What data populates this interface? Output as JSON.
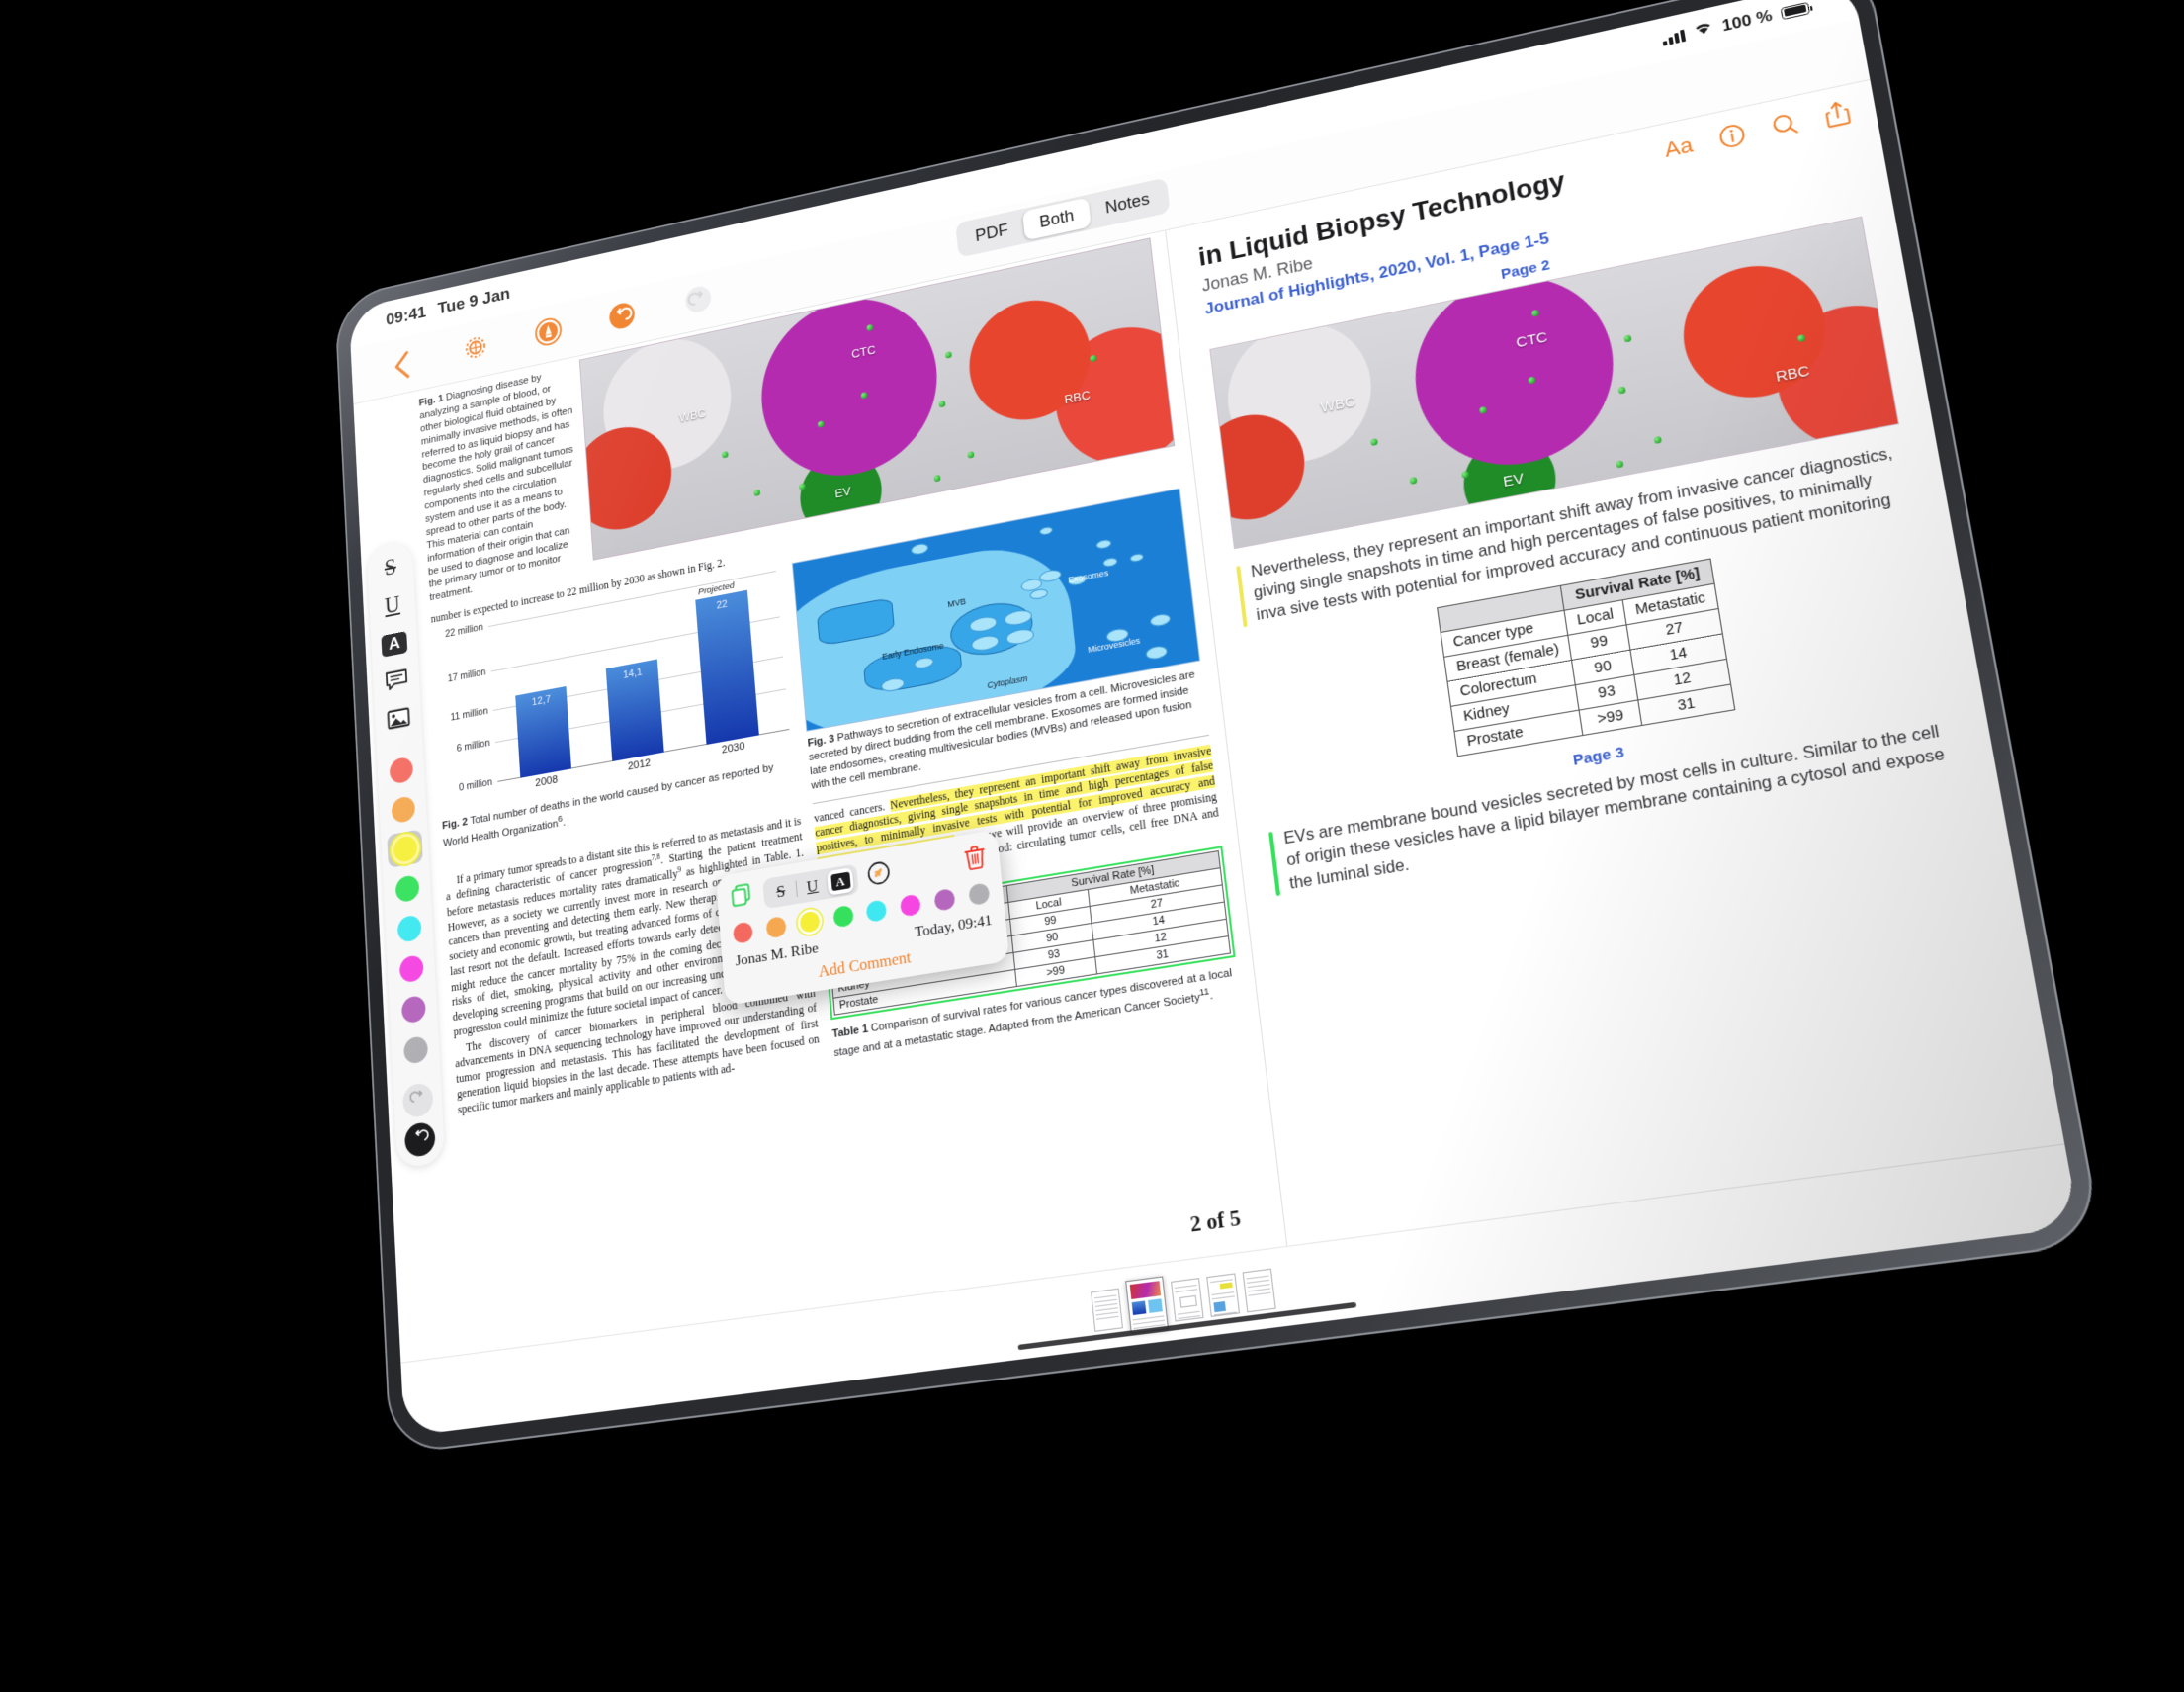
{
  "status_bar": {
    "time": "09:41",
    "date": "Tue 9 Jan",
    "battery_percent": "100 %"
  },
  "toolbar": {
    "back_icon": "chevron-left-icon",
    "settings_icon": "gear-icon",
    "annotate_icon": "pen-circle-icon",
    "undo_icon": "undo-icon",
    "redo_icon": "redo-icon"
  },
  "view_mode": {
    "options": [
      "PDF",
      "Both",
      "Notes"
    ],
    "selected": "Both"
  },
  "sidebar": {
    "tools": [
      {
        "name": "strikethrough-tool",
        "label": "S"
      },
      {
        "name": "underline-tool",
        "label": "U"
      },
      {
        "name": "highlight-tool",
        "label": "A",
        "selected": true
      },
      {
        "name": "comment-tool",
        "label": "comment-bubble-icon"
      },
      {
        "name": "image-tool",
        "label": "image-icon"
      }
    ],
    "colors": [
      {
        "name": "red",
        "hex": "#f4695f",
        "selected": false
      },
      {
        "name": "orange",
        "hex": "#f5a84f",
        "selected": false
      },
      {
        "name": "yellow",
        "hex": "#f6ef3a",
        "selected": true
      },
      {
        "name": "green",
        "hex": "#35e15c",
        "selected": false
      },
      {
        "name": "cyan",
        "hex": "#3fe8f0",
        "selected": false
      },
      {
        "name": "magenta",
        "hex": "#f martin",
        "selected": false
      },
      {
        "name": "purple",
        "hex": "#b566bd",
        "selected": false
      },
      {
        "name": "gray",
        "hex": "#b0b0b4",
        "selected": false
      }
    ],
    "redo_label": "redo-icon",
    "undo_label": "undo-icon"
  },
  "pdf": {
    "fig1": {
      "caption_prefix": "Fig. 1",
      "caption": "Diagnosing disease by analyzing a sample of blood, or other biological fluid obtained by minimally invasive methods, is often referred to as liquid biopsy and has become the holy grail of cancer diagnostics. Solid malignant tumors regularly shed cells and subcellular components into the circulation system and use it as a means to spread to other parts of the body. This material can contain information of their origin that can be used to diagnose and localize the primary tumor or to monitor treatment.",
      "image_labels": [
        "WBC",
        "CTC",
        "RBC",
        "EV"
      ]
    },
    "lead_text": "number is expected to increase to 22 million by 2030 as shown in Fig. 2.",
    "fig2_caption_prefix": "Fig. 2",
    "fig2_caption": "Total number of deaths in the world caused by cancer as reported by World Health Organization",
    "fig2_caption_sup": "6",
    "para_left_1": "If a primary tumor spreads to a distant site this is referred to as metastasis and it is a defining characteristic of cancer progression",
    "para_left_1b": ". Starting the patient treatment before metastasis reduces mortality rates dramatically",
    "para_left_1c": " as highlighted in Table. 1. However, as a society we currently invest more in research on treating advanced cancers than preventing and detecting them early. New therapies generally benefit society and economic growth, but treating advanced forms of cancer should be our last resort not the default. Increased efforts towards early detection and prevention might reduce the cancer mortality by 75% in the coming decades",
    "para_left_1d": ". Limiting the risks of diet, smoking, physical activity and other environmental factors while developing screening programs that build on our increasing understanding of tumor progression could minimize the future societal impact of cancer.",
    "para_left_2": "The discovery of cancer biomarkers in peripheral blood combined with advancements in DNA sequencing technology have improved our understanding of tumor progression and metastasis. This has facilitated the development of first generation liquid biopsies in the last decade. These attempts have been focused on specific tumor markers and mainly applicable to patients with ad-",
    "fig3": {
      "caption_prefix": "Fig. 3",
      "caption": "Pathways to secretion of extracellular vesicles from a cell. Microvesicles are secreted by direct budding from the cell membrane. Exosomes are formed inside late endosomes, creating multivesicular bodies (MVBs) and released upon fusion with the cell membrane.",
      "diagram_labels": [
        "Early Endosome",
        "MVB",
        "Exosomes",
        "Microvesicles",
        "Cytoplasm"
      ]
    },
    "para_right_lead": "vanced cancers. ",
    "para_right_highlight": "Nevertheless, they represent an important shift away from invasive cancer diagnostics, giving single snapshots in time and high percentages of false positives, to minimally invasive tests with potential for improved accuracy and continuous patient monitoring.",
    "para_right_tail": " Here, we will provide an overview of three promising circulating tumor markers found in blood: circulating tumor cells, cell free DNA and extracellular vesicles.",
    "table1_caption_prefix": "Table 1",
    "table1_caption": "Comparison of survival rates for various cancer types discovered at a local stage and at a metastatic stage. Adapted from the American Cancer Society",
    "table1_caption_sup": "11",
    "page_counter": "2 of 5"
  },
  "chart_data": {
    "type": "bar",
    "title": "",
    "categories": [
      "2008",
      "2012",
      "2030"
    ],
    "values": [
      12.7,
      14.1,
      22
    ],
    "value_labels": [
      "12,7",
      "14,1",
      "22"
    ],
    "annotations": [
      "Projected"
    ],
    "ytick_labels": [
      "0 million",
      "6 million",
      "11 million",
      "17 million",
      "22 million"
    ],
    "ytick_values": [
      0,
      6,
      11,
      17,
      22
    ],
    "ylim": [
      0,
      24
    ],
    "xlabel": "",
    "ylabel": "",
    "grid": true,
    "legend": "none",
    "caption": "Fig. 2 Total number of deaths in the world caused by cancer as reported by World Health Organization."
  },
  "popup": {
    "copy_icon": "copy-icon",
    "format_buttons": [
      {
        "name": "strikethrough-button",
        "label": "S",
        "active": false
      },
      {
        "name": "underline-button",
        "label": "U",
        "active": false
      },
      {
        "name": "highlight-button",
        "label": "A",
        "active": true
      }
    ],
    "link_icon": "link-icon",
    "delete_icon": "trash-icon",
    "colors": [
      {
        "name": "red",
        "hex": "#f4695f",
        "selected": false
      },
      {
        "name": "orange",
        "hex": "#f5a84f",
        "selected": false
      },
      {
        "name": "yellow",
        "hex": "#f6ef3a",
        "selected": true
      },
      {
        "name": "green",
        "hex": "#35e15c",
        "selected": false
      },
      {
        "name": "cyan",
        "hex": "#3fe8f0",
        "selected": false
      },
      {
        "name": "magenta",
        "hex": "#f546e2",
        "selected": false
      },
      {
        "name": "purple",
        "hex": "#b566bd",
        "selected": false
      },
      {
        "name": "gray",
        "hex": "#b0b0b4",
        "selected": false
      }
    ],
    "author": "Jonas M. Ribe",
    "timestamp": "Today, 09:41",
    "add_comment_label": "Add Comment"
  },
  "notes": {
    "title": "in Liquid Biopsy Technology",
    "author": "Jonas M. Ribe",
    "journal": "Journal of Highlights, 2020, Vol. 1, Page 1-5",
    "icons": [
      {
        "name": "text-size-icon",
        "label": "Aa"
      },
      {
        "name": "info-icon",
        "label": "i"
      },
      {
        "name": "search-icon",
        "label": "search"
      },
      {
        "name": "share-icon",
        "label": "share"
      }
    ],
    "page_2_label": "Page 2",
    "image_labels": [
      "WBC",
      "CTC",
      "RBC",
      "EV"
    ],
    "highlight_yellow": {
      "color": "#f0e85a",
      "text": "Nevertheless, they represent an important shift away from invasive cancer diagnostics, giving single snapshots in time and high percentages of false positives, to minimally inva sive tests with potential for improved accuracy and continuous patient monitoring"
    },
    "table": {
      "spanning_header": "Survival Rate [%]",
      "columns": [
        "Cancer type",
        "Local",
        "Metastatic"
      ],
      "rows": [
        [
          "Breast (female)",
          "99",
          "27"
        ],
        [
          "Colorectum",
          "90",
          "14"
        ],
        [
          "Kidney",
          "93",
          "12"
        ],
        [
          "Prostate",
          ">99",
          "31"
        ]
      ]
    },
    "page_3_label": "Page 3",
    "highlight_green": {
      "color": "#35e15c",
      "text": "EVs are membrane bound vesicles secreted by most cells in culture. Similar to the cell of origin these vesicles have a lipid bilayer membrane containing a cytosol and expose the luminal side."
    }
  },
  "thumbnails": {
    "count": 5,
    "selected_index": 1
  }
}
